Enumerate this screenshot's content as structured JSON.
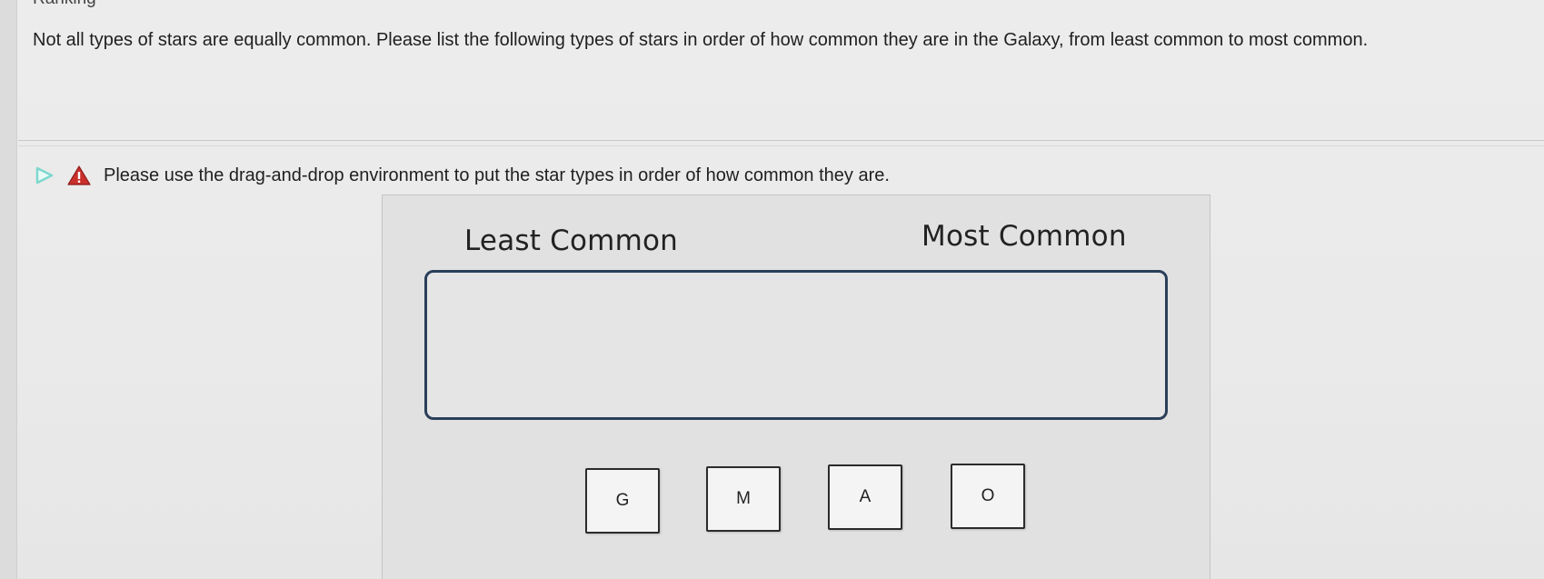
{
  "section": {
    "heading": "Ranking"
  },
  "question": {
    "text": "Not all types of stars are equally common. Please list the following types of stars in order of how common they are in the Galaxy, from least common to most common."
  },
  "part": {
    "expand_icon": "triangle-right-icon",
    "status_icon": "warning-icon",
    "prompt": "Please use the drag-and-drop environment to put the star types in order of how common they are."
  },
  "dnd": {
    "label_left": "Least Common",
    "label_right": "Most Common",
    "tiles": [
      "G",
      "M",
      "A",
      "O"
    ]
  },
  "colors": {
    "expand_icon": "#7ed8cf",
    "warning_fill": "#c9302c",
    "drop_zone_border": "#2a3f59"
  }
}
